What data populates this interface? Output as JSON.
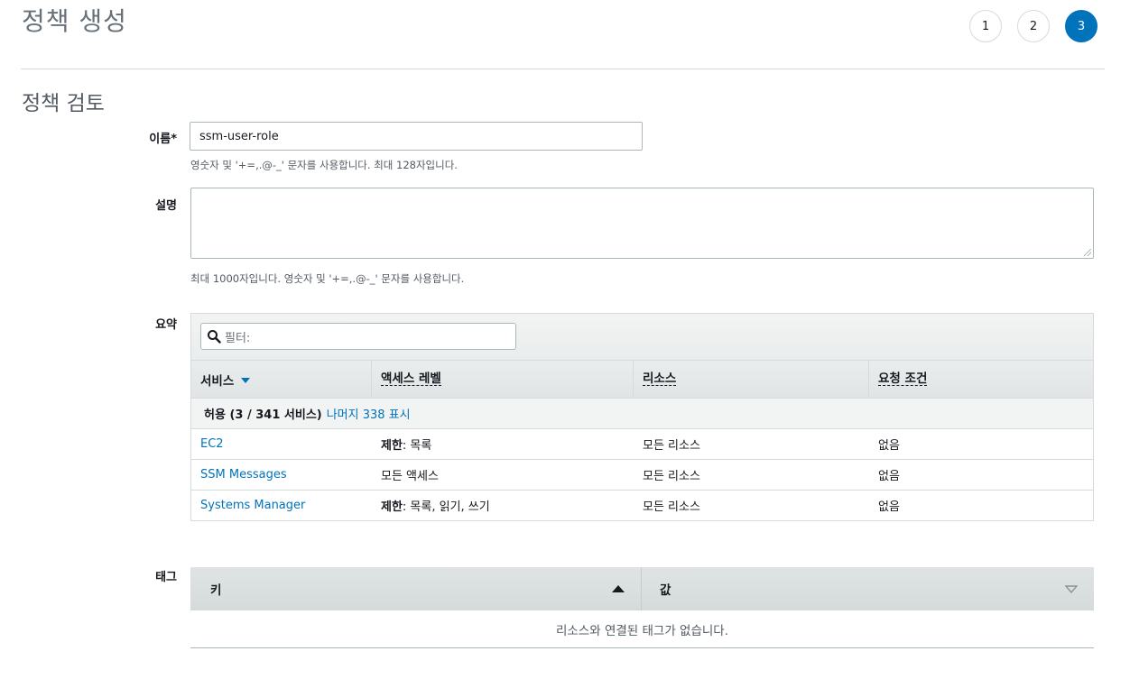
{
  "page": {
    "title": "정책 생성"
  },
  "steps": [
    "1",
    "2",
    "3"
  ],
  "active_step": 3,
  "section": {
    "title": "정책 검토"
  },
  "name_field": {
    "label": "이름*",
    "value": "ssm-user-role",
    "hint": "영숫자 및 '+=,.@-_' 문자를 사용합니다. 최대 128자입니다."
  },
  "description_field": {
    "label": "설명",
    "value": "",
    "hint": "최대 1000자입니다. 영숫자 및 '+=,.@-_' 문자를 사용합니다."
  },
  "summary": {
    "label": "요약",
    "filter_placeholder": "필터:",
    "columns": [
      "서비스",
      "액세스 레벨",
      "리소스",
      "요청 조건"
    ],
    "group": {
      "label": "허용 (3 / 341 서비스)",
      "link": "나머지 338 표시"
    },
    "rows": [
      {
        "service": "EC2",
        "access_bold": "제한",
        "access_rest": ": 목록",
        "resource": "모든 리소스",
        "condition": "없음"
      },
      {
        "service": "SSM Messages",
        "access_bold": "",
        "access_rest": "모든 액세스",
        "resource": "모든 리소스",
        "condition": "없음"
      },
      {
        "service": "Systems Manager",
        "access_bold": "제한",
        "access_rest": ": 목록, 읽기, 쓰기",
        "resource": "모든 리소스",
        "condition": "없음"
      }
    ]
  },
  "tags": {
    "label": "태그",
    "columns": [
      "키",
      "값"
    ],
    "empty_message": "리소스와 연결된 태그가 없습니다."
  },
  "colors": {
    "accent": "#0073bb",
    "text": "#16191f",
    "muted": "#545b64",
    "border": "#d5dbdb"
  },
  "icons": [
    "search-icon",
    "sort-desc-icon",
    "sort-asc-icon",
    "sort-desc-outline-icon"
  ]
}
